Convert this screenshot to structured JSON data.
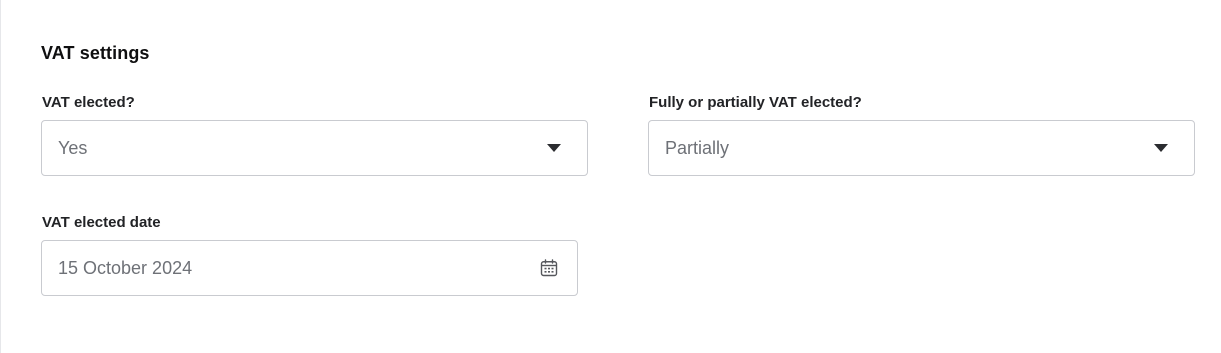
{
  "section": {
    "title": "VAT settings"
  },
  "vat_elected": {
    "label": "VAT elected?",
    "value": "Yes",
    "icon": "chevron-down-icon"
  },
  "vat_elected_type": {
    "label": "Fully or partially VAT elected?",
    "value": "Partially",
    "icon": "chevron-down-icon"
  },
  "vat_elected_date": {
    "label": "VAT elected date",
    "value": "15 October 2024",
    "icon": "calendar-icon"
  },
  "colors": {
    "border": "#c9cbd0",
    "value_text": "#6e7177",
    "label_text": "#222326",
    "icon": "#2b2c30"
  }
}
